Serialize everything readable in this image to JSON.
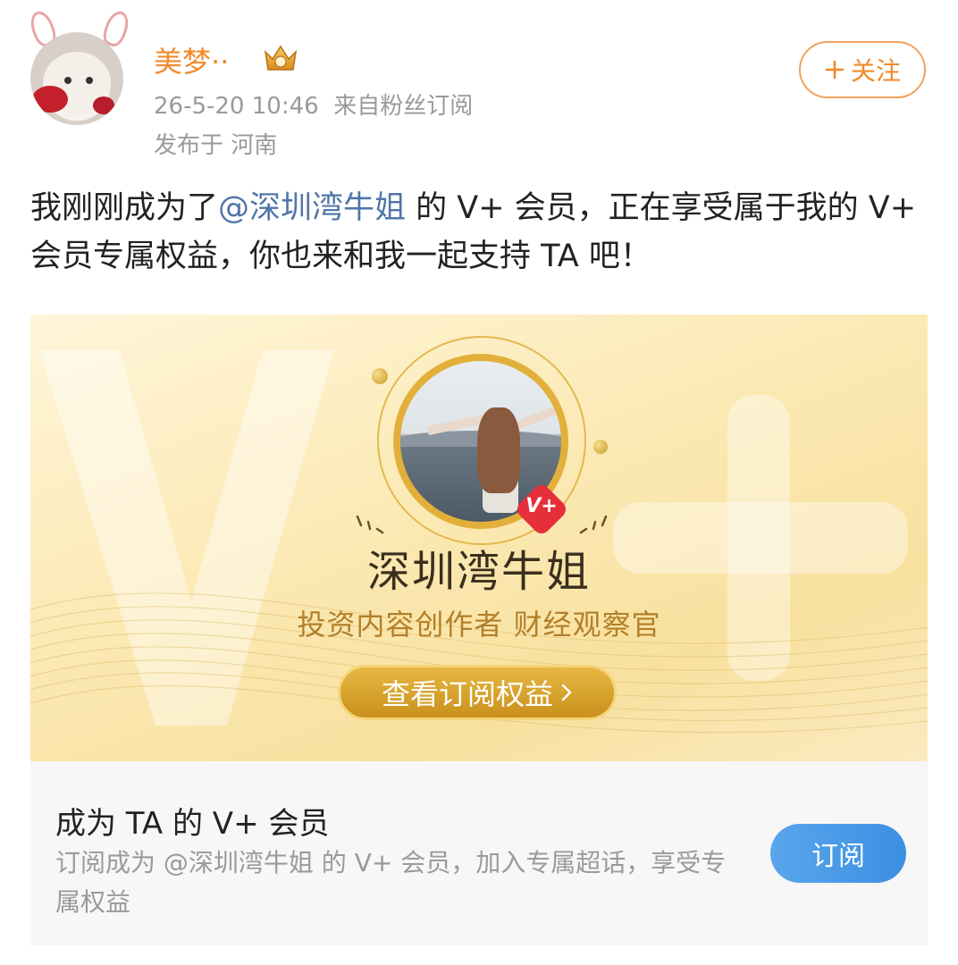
{
  "post": {
    "author": "美梦··",
    "time": "26-5-20 10:46",
    "source": "来自粉丝订阅",
    "location": "发布于 河南",
    "follow_label": "关注",
    "text_before": "我刚刚成为了",
    "mention": "@深圳湾牛姐",
    "text_after": " 的 V+ 会员，正在享受属于我的 V+ 会员专属权益，你也来和我一起支持 TA 吧！"
  },
  "card": {
    "creator_name": "深圳湾牛姐",
    "creator_title": "投资内容创作者 财经观察官",
    "badge": "V+",
    "button_label": "查看订阅权益",
    "watermark": "V+"
  },
  "footer": {
    "title": "成为 TA 的 V+ 会员",
    "description": "订阅成为 @深圳湾牛姐 的 V+ 会员，加入专属超话，享受专属权益",
    "subscribe_label": "订阅"
  },
  "colors": {
    "accent": "#f08a2b",
    "mention": "#5176a8",
    "gold": "#c9901c",
    "subscribe_blue": "#3b8fe3"
  },
  "icons": [
    "crown-icon",
    "plus-icon",
    "chevron-right-icon",
    "v-plus-badge-icon"
  ]
}
